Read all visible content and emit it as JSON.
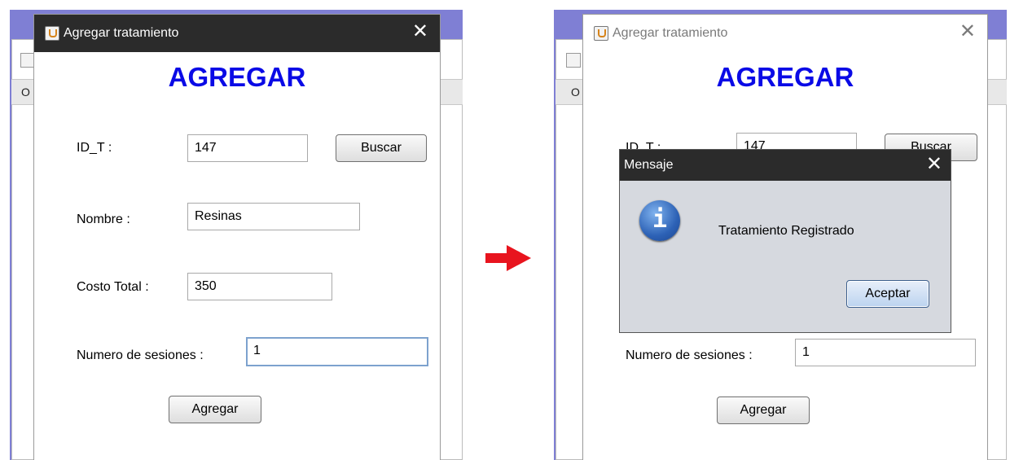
{
  "arrow_color": "#e8141e",
  "left_panel": {
    "background_window": {
      "menu_letter": "O"
    },
    "dialog": {
      "title": "Agregar tratamiento",
      "close": "✕",
      "heading": "AGREGAR",
      "id_label": "ID_T :",
      "id_value": "147",
      "buscar_label": "Buscar",
      "nombre_label": "Nombre :",
      "nombre_value": "Resinas",
      "costo_label": "Costo Total :",
      "costo_value": "350",
      "sesiones_label": "Numero de sesiones :",
      "sesiones_value": "1",
      "agregar_label": "Agregar"
    }
  },
  "right_panel": {
    "background_window": {
      "menu_letter": "O"
    },
    "dialog": {
      "title": "Agregar tratamiento",
      "close": "✕",
      "heading": "AGREGAR",
      "id_label": "ID_T :",
      "id_value": "147",
      "buscar_label": "Buscar",
      "sesiones_label": "Numero de sesiones :",
      "sesiones_value": "1",
      "agregar_label": "Agregar"
    },
    "message": {
      "title": "Mensaje",
      "close": "✕",
      "icon": "info-icon",
      "icon_glyph": "i",
      "text": "Tratamiento Registrado",
      "accept_label": "Aceptar"
    }
  }
}
